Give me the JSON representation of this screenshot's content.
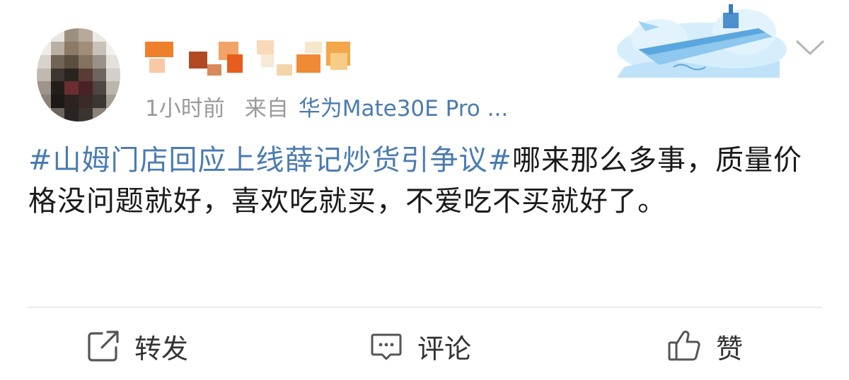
{
  "post": {
    "meta": {
      "time": "1小时前",
      "from_label": "来自",
      "device": "华为Mate30E Pro ..."
    },
    "content": {
      "topic": "#山姆门店回应上线薛记炒货引争议#",
      "text": "哪来那么多事，质量价格没问题就好，喜欢吃就买，不爱吃不买就好了。"
    },
    "actions": {
      "repost": "转发",
      "comment": "评论",
      "like": "赞"
    }
  },
  "icons": {
    "avatar": "avatar-pixelated",
    "username": "username-pixelated",
    "badge": "aircraft-carrier-cloud-icon",
    "more": "chevron-down-icon",
    "repost": "repost-icon",
    "comment": "comment-icon",
    "like": "thumbs-up-icon"
  },
  "colors": {
    "link": "#4a7bb0",
    "meta": "#9a9a9a",
    "text": "#1a1a1a",
    "divider": "#ececec"
  }
}
